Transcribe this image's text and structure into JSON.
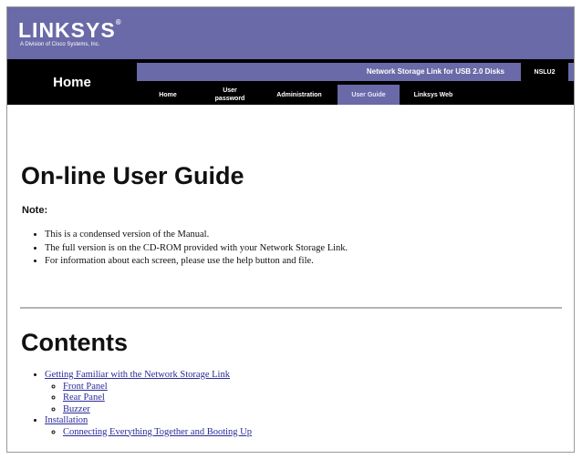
{
  "header": {
    "logo_text": "LINKSYS",
    "logo_mark": "®",
    "tagline": "A Division of Cisco Systems, Inc.",
    "home_title": "Home",
    "product_name": "Network Storage Link for USB 2.0 Disks",
    "model": "NSLU2",
    "tabs": [
      {
        "label": "Home"
      },
      {
        "label": "User password"
      },
      {
        "label": "Administration"
      },
      {
        "label": "User Guide"
      },
      {
        "label": "Linksys Web"
      }
    ],
    "active_tab": "User Guide"
  },
  "guide": {
    "title": "On-line User Guide",
    "note_label": "Note:",
    "notes": [
      "This is a condensed version of the Manual.",
      "The full version is on the CD-ROM provided with your Network Storage Link.",
      "For information about each screen, please use the help button and file."
    ]
  },
  "contents": {
    "title": "Contents",
    "items": [
      {
        "label": "Getting Familiar with the Network Storage Link",
        "children": [
          "Front Panel",
          "Rear Panel",
          "Buzzer"
        ]
      },
      {
        "label": "Installation",
        "children": [
          "Connecting Everything Together and Booting Up"
        ]
      }
    ]
  }
}
